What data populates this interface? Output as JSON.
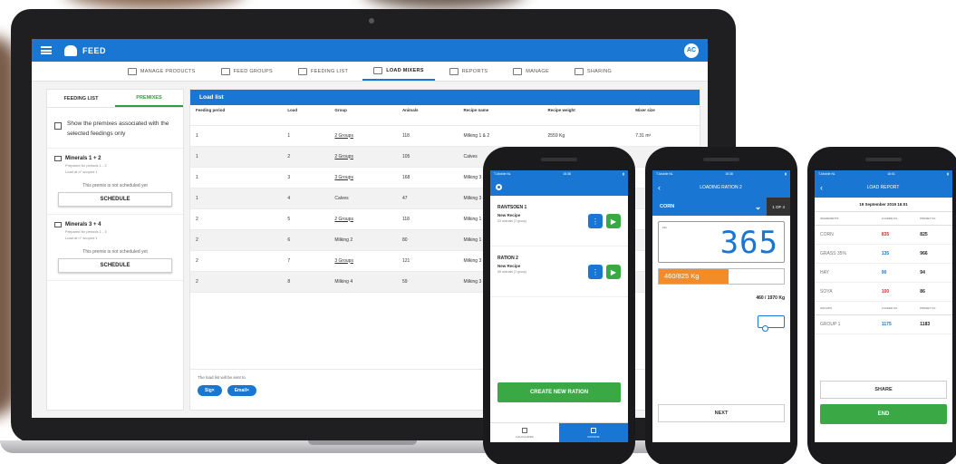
{
  "colors": {
    "primary": "#1976d2",
    "green": "#3aa845",
    "orange": "#f28c28",
    "red": "#d32f2f"
  },
  "app": {
    "title": "FEED",
    "avatar": "AC"
  },
  "nav": [
    {
      "label": "MANAGE PRODUCTS",
      "icon": "products-icon"
    },
    {
      "label": "FEED GROUPS",
      "icon": "groups-icon"
    },
    {
      "label": "FEEDING LIST",
      "icon": "list-icon"
    },
    {
      "label": "LOAD MIXERS",
      "icon": "mixer-icon"
    },
    {
      "label": "REPORTS",
      "icon": "reports-icon"
    },
    {
      "label": "MANAGE",
      "icon": "manage-icon"
    },
    {
      "label": "SHARING",
      "icon": "share-icon"
    }
  ],
  "left_panel": {
    "tabs": [
      "FEEDING LIST",
      "PREMIXES"
    ],
    "checkbox_text": "Show the premixes associated with the selected feedings only",
    "premixes": [
      {
        "name": "Minerals 1 + 2",
        "sub1": "Prepared for periods 1 - 2",
        "sub2": "Load at n° scoped 1",
        "note": "This premix is not scheduled yet",
        "button": "SCHEDULE"
      },
      {
        "name": "Minerals 3 + 4",
        "sub1": "Prepared for periods 1 - 3",
        "sub2": "Load at n° scoped 1",
        "note": "This premix is not scheduled yet",
        "button": "SCHEDULE"
      }
    ]
  },
  "load_list": {
    "title": "Load list",
    "columns": [
      "Feeding period",
      "Load",
      "Group",
      "Animals",
      "Recipe name",
      "Recipe weight",
      "Mixer size"
    ],
    "rows": [
      [
        "1",
        "1",
        "2 Groups",
        "118",
        "Milking 1 & 2",
        "2559 Kg",
        "7.31 m³"
      ],
      [
        "1",
        "2",
        "2 Groups",
        "105",
        "Calves",
        "",
        ""
      ],
      [
        "1",
        "3",
        "3 Groups",
        "168",
        "Milking 3 & 4",
        "",
        ""
      ],
      [
        "1",
        "4",
        "Calves",
        "47",
        "Milking 3 & 4",
        "",
        ""
      ],
      [
        "2",
        "5",
        "2 Groups",
        "118",
        "Milking 1 & 2",
        "",
        ""
      ],
      [
        "2",
        "6",
        "Milking 2",
        "80",
        "Milking 1 & 2",
        "",
        ""
      ],
      [
        "2",
        "7",
        "3 Groups",
        "121",
        "Milking 3 & 4",
        "",
        ""
      ],
      [
        "2",
        "8",
        "Milking 4",
        "59",
        "Milking 3 & 4",
        "",
        ""
      ]
    ],
    "footer_text": "The load list will be sent to",
    "chips": [
      "Sig",
      "Email"
    ]
  },
  "phone1": {
    "status_left": "T-Mobile NL",
    "status_time": "15:38",
    "rations": [
      {
        "name": "RANTSOEN 1",
        "recipe": "New Recipe",
        "meta": "53 animals (1 group)"
      },
      {
        "name": "RATION 2",
        "recipe": "New Recipe",
        "meta": "68 animals (1 group)"
      }
    ],
    "create_button": "CREATE NEW RATION",
    "tabs": [
      "CALCULATED",
      "RATIONS"
    ]
  },
  "phone2": {
    "status_left": "T-Mobile NL",
    "status_time": "15:38",
    "title": "LOADING RATION 2",
    "ingredient": "CORN",
    "count": "1 OF 4",
    "scale_label": "Kilo",
    "scale_value": "365",
    "progress_text": "460/825 Kg",
    "progress_fraction": 0.56,
    "total": "460 / 1970 Kg",
    "next_button": "NEXT"
  },
  "phone3": {
    "status_left": "T-Mobile NL",
    "status_time": "16:01",
    "title": "LOAD REPORT",
    "date": "19 September 2019 16:01",
    "headers": [
      "INGREDIENTS",
      "LOADED KG",
      "PRESET KG"
    ],
    "rows": [
      {
        "name": "CORN",
        "loaded": "835",
        "preset": "825",
        "color": "#d32f2f"
      },
      {
        "name": "GRASS 35%",
        "loaded": "135",
        "preset": "966",
        "color": "#1976d2"
      },
      {
        "name": "HAY",
        "loaded": "90",
        "preset": "94",
        "color": "#1976d2"
      },
      {
        "name": "SOYA",
        "loaded": "100",
        "preset": "86",
        "color": "#d32f2f"
      }
    ],
    "group_headers": [
      "GROUPS",
      "LOADED KG",
      "PRESET KG"
    ],
    "group_rows": [
      {
        "name": "GROUP 1",
        "loaded": "1175",
        "preset": "1183",
        "color": "#1976d2"
      }
    ],
    "share_button": "SHARE",
    "end_button": "END"
  }
}
